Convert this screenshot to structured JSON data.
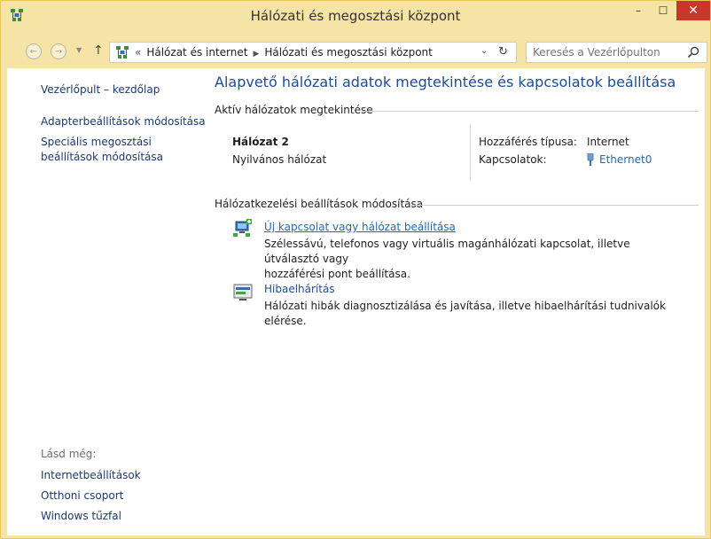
{
  "window": {
    "title": "Hálózati és megosztási központ",
    "min_glyph": "–",
    "max_glyph": "☐",
    "close_glyph": "✕"
  },
  "nav": {
    "back_glyph": "←",
    "forward_glyph": "→",
    "recent_glyph": "▼",
    "up_glyph": "↑"
  },
  "address": {
    "lead": "«",
    "crumbs": [
      "Hálózat és internet",
      "Hálózati és megosztási központ"
    ],
    "separator": "▶",
    "dropdown_glyph": "⌄",
    "refresh_glyph": "↻"
  },
  "search": {
    "placeholder": "Keresés a Vezérlőpulton"
  },
  "sidebar": {
    "home": "Vezérlőpult – kezdőlap",
    "adapter": "Adapterbeállítások módosítása",
    "sharing_line1": "Speciális megosztási",
    "sharing_line2": "beállítások módosítása",
    "see_also": "Lásd még:",
    "links": [
      "Internetbeállítások",
      "Otthoni csoport",
      "Windows tűzfal"
    ]
  },
  "main": {
    "title": "Alapvető hálózati adatok megtekintése és kapcsolatok beállítása",
    "active_section": "Aktív hálózatok megtekintése",
    "network": {
      "name": "Hálózat  2",
      "type": "Nyilvános hálózat",
      "access_label": "Hozzáférés típusa:",
      "access_value": "Internet",
      "connections_label": "Kapcsolatok:",
      "connection_value": "Ethernet0"
    },
    "settings_section": "Hálózatkezelési beállítások módosítása",
    "tasks": [
      {
        "title": "Új kapcsolat vagy hálózat beállítása",
        "desc_line1": "Szélessávú, telefonos vagy virtuális magánhálózati kapcsolat, illetve útválasztó vagy",
        "desc_line2": "hozzáférési pont beállítása."
      },
      {
        "title": "Hibaelhárítás",
        "desc_line1": "Hálózati hibák diagnosztizálása és javítása, illetve hibaelhárítási tudnivalók elérése."
      }
    ]
  },
  "colors": {
    "frame": "#f6e4a6",
    "link": "#1e6ab8",
    "title_blue": "#1e4d94",
    "close_red": "#c7382b"
  }
}
